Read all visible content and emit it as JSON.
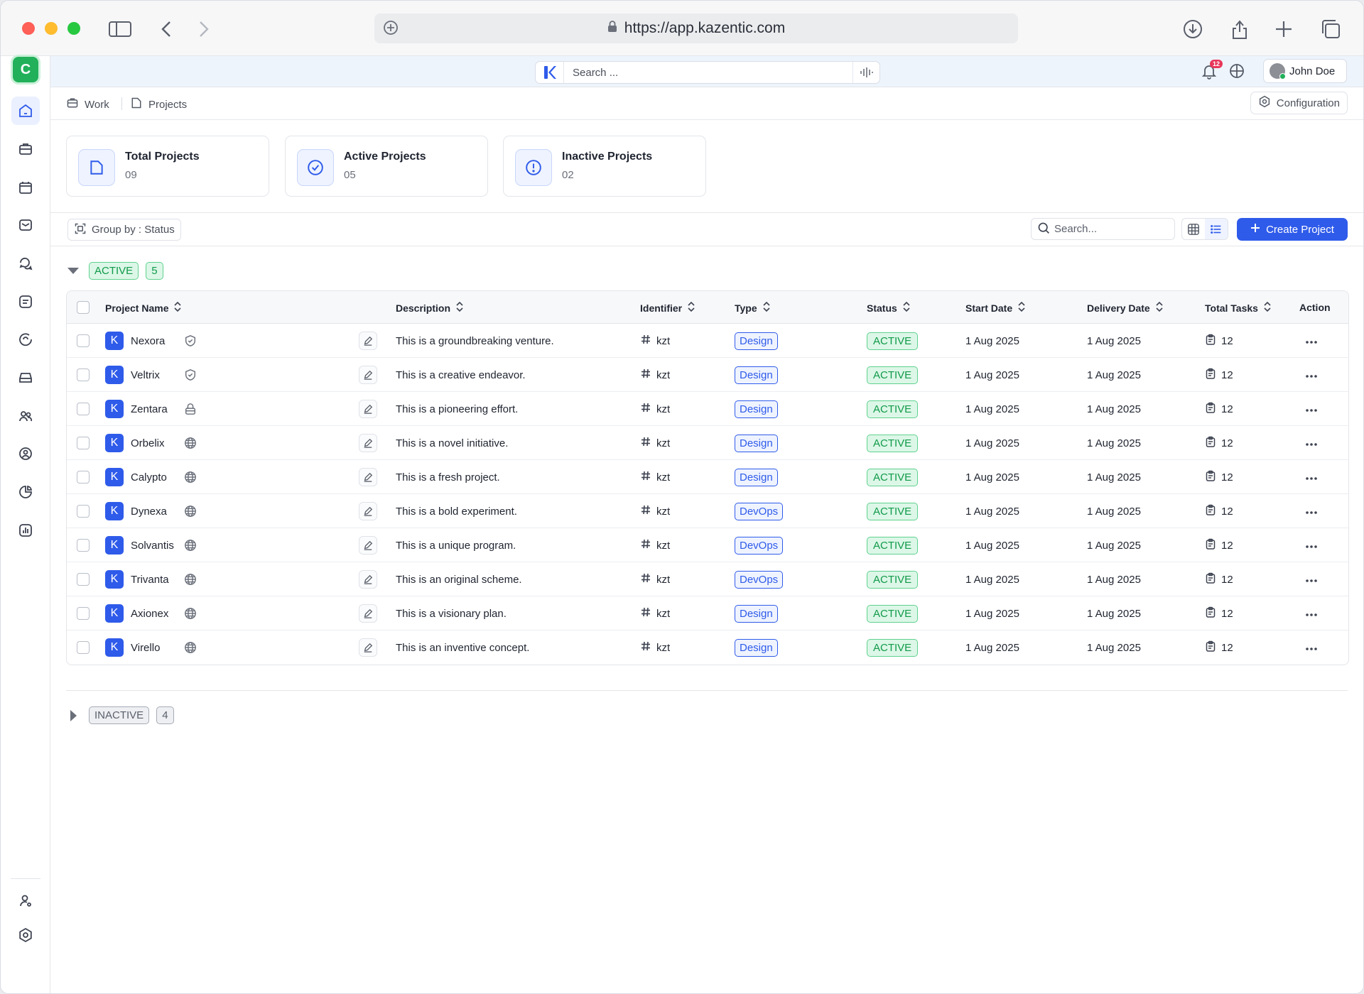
{
  "browser": {
    "url": "https://app.kazentic.com"
  },
  "app": {
    "workspace_initial": "C",
    "search_placeholder": "Search ...",
    "notification_count": "12",
    "user_name": "John Doe",
    "accent_color": "#2f5bea",
    "success_color": "#22b05a"
  },
  "breadcrumb": {
    "work": "Work",
    "projects": "Projects"
  },
  "configuration_label": "Configuration",
  "stats": [
    {
      "title": "Total Projects",
      "value": "09",
      "icon": "folder-icon"
    },
    {
      "title": "Active Projects",
      "value": "05",
      "icon": "check-circle-icon"
    },
    {
      "title": "Inactive Projects",
      "value": "02",
      "icon": "alert-circle-icon"
    }
  ],
  "toolbar": {
    "group_by": "Group by : Status",
    "search_placeholder": "Search...",
    "create_label": "Create Project"
  },
  "groups": {
    "active": {
      "label": "ACTIVE",
      "count": "5"
    },
    "inactive": {
      "label": "INACTIVE",
      "count": "4"
    }
  },
  "table": {
    "columns": {
      "name": "Project Name",
      "description": "Description",
      "identifier": "Identifier",
      "type": "Type",
      "status": "Status",
      "start": "Start Date",
      "delivery": "Delivery Date",
      "tasks": "Total Tasks",
      "action": "Action"
    },
    "rows": [
      {
        "logo": "K",
        "name": "Nexora",
        "privacy_icon": "shield-icon",
        "description": "This is a groundbreaking venture.",
        "identifier": "kzt",
        "type": "Design",
        "status": "ACTIVE",
        "start": "1 Aug 2025",
        "delivery": "1 Aug 2025",
        "tasks": "12"
      },
      {
        "logo": "K",
        "name": "Veltrix",
        "privacy_icon": "shield-icon",
        "description": "This is a creative endeavor.",
        "identifier": "kzt",
        "type": "Design",
        "status": "ACTIVE",
        "start": "1 Aug 2025",
        "delivery": "1 Aug 2025",
        "tasks": "12"
      },
      {
        "logo": "K",
        "name": "Zentara",
        "privacy_icon": "lock-icon",
        "description": "This is a pioneering effort.",
        "identifier": "kzt",
        "type": "Design",
        "status": "ACTIVE",
        "start": "1 Aug 2025",
        "delivery": "1 Aug 2025",
        "tasks": "12"
      },
      {
        "logo": "K",
        "name": "Orbelix",
        "privacy_icon": "globe-icon",
        "description": "This is a novel initiative.",
        "identifier": "kzt",
        "type": "Design",
        "status": "ACTIVE",
        "start": "1 Aug 2025",
        "delivery": "1 Aug 2025",
        "tasks": "12"
      },
      {
        "logo": "K",
        "name": "Calypto",
        "privacy_icon": "globe-icon",
        "description": "This is a fresh project.",
        "identifier": "kzt",
        "type": "Design",
        "status": "ACTIVE",
        "start": "1 Aug 2025",
        "delivery": "1 Aug 2025",
        "tasks": "12"
      },
      {
        "logo": "K",
        "name": "Dynexa",
        "privacy_icon": "globe-icon",
        "description": "This is a bold experiment.",
        "identifier": "kzt",
        "type": "DevOps",
        "status": "ACTIVE",
        "start": "1 Aug 2025",
        "delivery": "1 Aug 2025",
        "tasks": "12"
      },
      {
        "logo": "K",
        "name": "Solvantis",
        "privacy_icon": "globe-icon",
        "description": "This is a unique program.",
        "identifier": "kzt",
        "type": "DevOps",
        "status": "ACTIVE",
        "start": "1 Aug 2025",
        "delivery": "1 Aug 2025",
        "tasks": "12"
      },
      {
        "logo": "K",
        "name": "Trivanta",
        "privacy_icon": "globe-icon",
        "description": "This is an original scheme.",
        "identifier": "kzt",
        "type": "DevOps",
        "status": "ACTIVE",
        "start": "1 Aug 2025",
        "delivery": "1 Aug 2025",
        "tasks": "12"
      },
      {
        "logo": "K",
        "name": "Axionex",
        "privacy_icon": "globe-icon",
        "description": "This is a visionary plan.",
        "identifier": "kzt",
        "type": "Design",
        "status": "ACTIVE",
        "start": "1 Aug 2025",
        "delivery": "1 Aug 2025",
        "tasks": "12"
      },
      {
        "logo": "K",
        "name": "Virello",
        "privacy_icon": "globe-icon",
        "description": "This is an inventive concept.",
        "identifier": "kzt",
        "type": "Design",
        "status": "ACTIVE",
        "start": "1 Aug 2025",
        "delivery": "1 Aug 2025",
        "tasks": "12"
      }
    ]
  }
}
